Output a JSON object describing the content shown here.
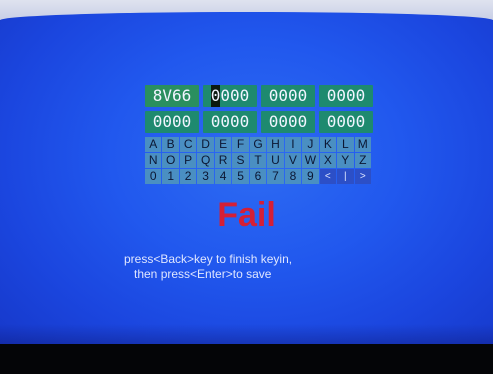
{
  "code_rows": [
    [
      "8V66",
      "0000",
      "0000",
      "0000"
    ],
    [
      "0000",
      "0000",
      "0000",
      "0000"
    ]
  ],
  "keyboard": [
    [
      "A",
      "B",
      "C",
      "D",
      "E",
      "F",
      "G",
      "H",
      "I",
      "J",
      "K",
      "L",
      "M"
    ],
    [
      "N",
      "O",
      "P",
      "Q",
      "R",
      "S",
      "T",
      "U",
      "V",
      "W",
      "X",
      "Y",
      "Z"
    ],
    [
      "0",
      "1",
      "2",
      "3",
      "4",
      "5",
      "6",
      "7",
      "8",
      "9",
      "<",
      "|",
      ">"
    ]
  ],
  "status": "Fail",
  "instructions": {
    "line1": "press<Back>key to finish keyin,",
    "line2": "then press<Enter>to save"
  },
  "colors": {
    "screen": "#2158ee",
    "code_cell": "#1e8a6f",
    "key": "#4a8fc2",
    "fail": "#d51f36"
  }
}
